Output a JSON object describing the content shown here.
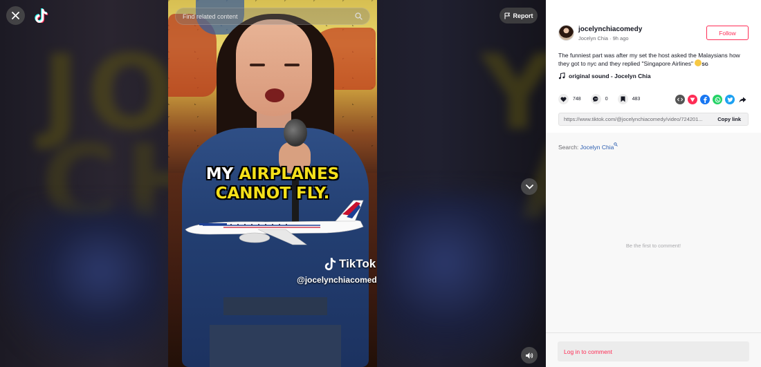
{
  "viewer": {
    "search": {
      "placeholder": "Find related content"
    },
    "report_label": "Report",
    "video": {
      "caption_line1_white": "MY ",
      "caption_line1_yellow": "AIRPLANES",
      "caption_line2_yellow": "CANNOT FLY.",
      "watermark_brand": "TikTok",
      "watermark_handle": "@jocelynchiacomedy"
    }
  },
  "post": {
    "username": "jocelynchiacomedy",
    "display_name": "Jocelyn Chia",
    "time_ago": "9h ago",
    "follow_label": "Follow",
    "description": "The funniest part was after my set the host asked the Malaysians how they got to nyc and they replied \"Singapore Airlines\" ",
    "flag_text": "SG",
    "sound": "original sound - Jocelyn Chia",
    "stats": {
      "likes": "748",
      "comments": "0",
      "saves": "483"
    },
    "share_icons": [
      "embed-icon",
      "friends-icon",
      "facebook-icon",
      "whatsapp-icon",
      "twitter-icon",
      "share-arrow-icon"
    ],
    "link_url": "https://www.tiktok.com/@jocelynchiacomedy/video/724201...",
    "copy_link_label": "Copy link"
  },
  "comments": {
    "search_prefix": "Search: ",
    "search_query": "Jocelyn Chia",
    "empty_text": "Be the first to comment!",
    "login_label": "Log in to comment"
  },
  "colors": {
    "accent": "#fe2c55",
    "link": "#2b5db0",
    "caption_yellow": "#f4e01a"
  }
}
